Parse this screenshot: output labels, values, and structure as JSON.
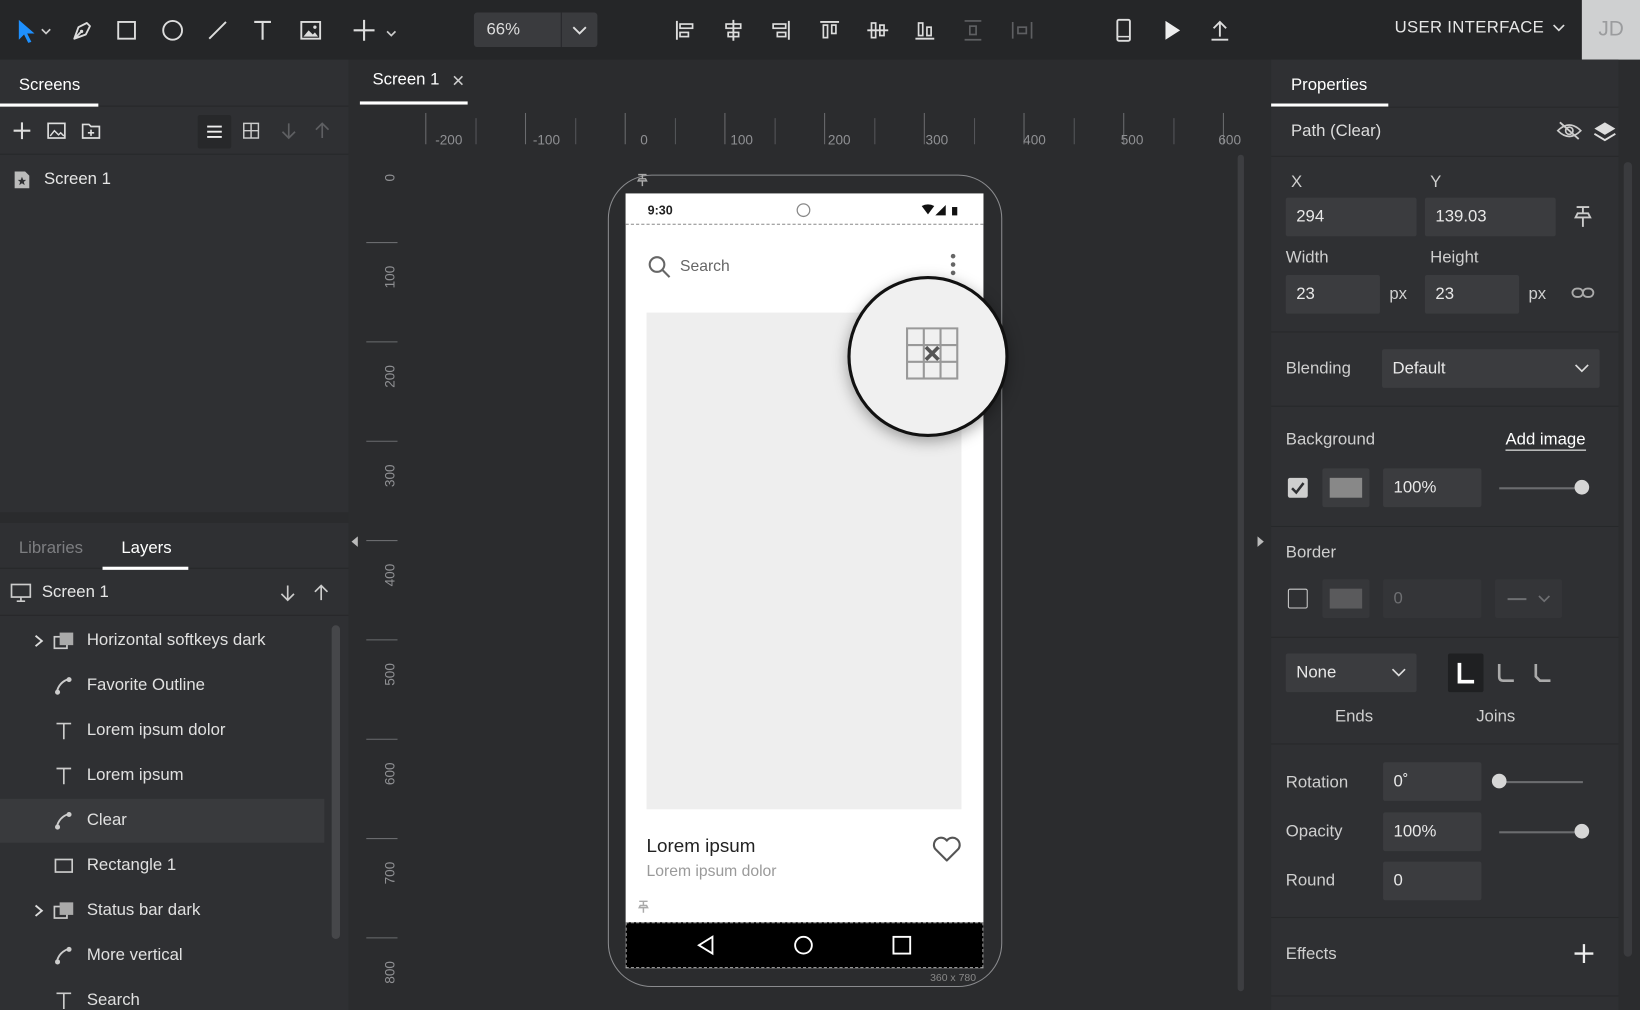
{
  "toolbar": {
    "zoom": "66%",
    "project_menu": "USER INTERFACE",
    "avatar_initials": "JD"
  },
  "screens_panel": {
    "tab": "Screens",
    "items": [
      "Screen 1"
    ]
  },
  "canvas": {
    "tab": "Screen 1",
    "ruler_top": [
      "-200",
      "-100",
      "0",
      "100",
      "200",
      "300",
      "400",
      "500",
      "600"
    ],
    "ruler_left": [
      "0",
      "100",
      "200",
      "300",
      "400",
      "500",
      "600",
      "700",
      "800"
    ],
    "size_label": "360 x 780"
  },
  "phone": {
    "time": "9:30",
    "search_placeholder": "Search",
    "card_title": "Lorem ipsum",
    "card_subtitle": "Lorem ipsum dolor"
  },
  "layers_panel": {
    "tabs": [
      "Libraries",
      "Layers"
    ],
    "screen": "Screen 1",
    "layers": [
      {
        "name": "Horizontal softkeys dark",
        "icon": "group-icon",
        "expandable": true
      },
      {
        "name": "Favorite Outline",
        "icon": "path-icon",
        "expandable": false
      },
      {
        "name": "Lorem ipsum dolor",
        "icon": "text-icon",
        "expandable": false
      },
      {
        "name": "Lorem ipsum",
        "icon": "text-icon",
        "expandable": false
      },
      {
        "name": "Clear",
        "icon": "path-icon",
        "expandable": false,
        "selected": true
      },
      {
        "name": "Rectangle 1",
        "icon": "rectangle-icon",
        "expandable": false
      },
      {
        "name": "Status bar dark",
        "icon": "group-icon",
        "expandable": true
      },
      {
        "name": "More vertical",
        "icon": "path-icon",
        "expandable": false
      },
      {
        "name": "Search",
        "icon": "text-icon",
        "expandable": false
      }
    ]
  },
  "properties": {
    "tab": "Properties",
    "element": "Path (Clear)",
    "x_label": "X",
    "x": "294",
    "y_label": "Y",
    "y": "139.03",
    "width_label": "Width",
    "width": "23",
    "width_unit": "px",
    "height_label": "Height",
    "height": "23",
    "height_unit": "px",
    "blending_label": "Blending",
    "blending": "Default",
    "background_label": "Background",
    "add_image": "Add image",
    "background_opacity": "100%",
    "border_label": "Border",
    "border_value": "0",
    "ends_value": "None",
    "ends_label": "Ends",
    "joins_label": "Joins",
    "rotation_label": "Rotation",
    "rotation": "0˚",
    "opacity_label": "Opacity",
    "opacity": "100%",
    "round_label": "Round",
    "round": "0",
    "effects_label": "Effects",
    "colors": {
      "accent": "#ffffff",
      "panel": "#2f3033",
      "field": "#3b3c3f"
    }
  }
}
